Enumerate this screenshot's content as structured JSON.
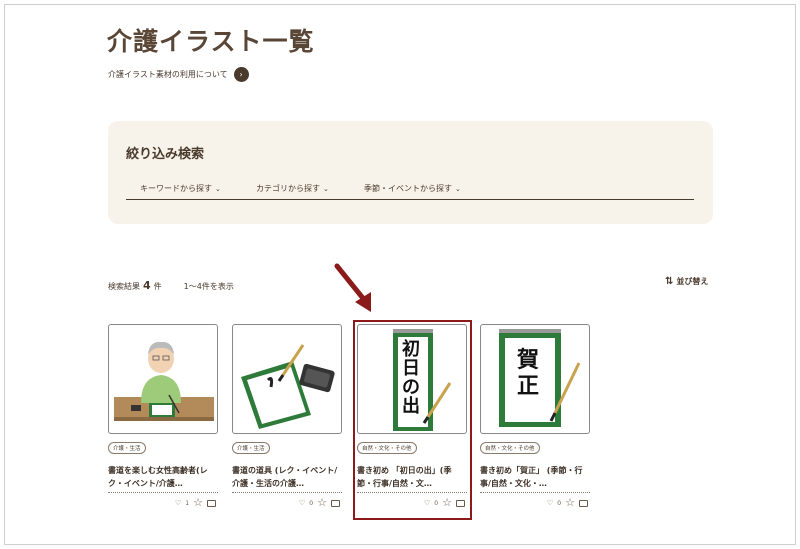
{
  "page": {
    "title": "介護イラスト一覧"
  },
  "about_link": {
    "label": "介護イラスト素材の利用について"
  },
  "filter": {
    "title": "絞り込み検索",
    "tabs": [
      {
        "label": "キーワードから探す"
      },
      {
        "label": "カテゴリから探す"
      },
      {
        "label": "季節・イベントから探す"
      }
    ]
  },
  "results": {
    "label": "検索結果",
    "count": "4",
    "unit": "件",
    "range": "1～4件を表示",
    "sort_label": "並び替え"
  },
  "cards": [
    {
      "tag": "介護・生活",
      "title": "書道を楽しむ女性高齢者(レク・イベント/介護…",
      "likes": "1",
      "thumb_icon": "elderly-calligraphy"
    },
    {
      "tag": "介護・生活",
      "title": "書道の道具 (レク・イベント/介護・生活の介護…",
      "likes": "0",
      "thumb_icon": "calligraphy-tools"
    },
    {
      "tag": "自然・文化・その他",
      "title": "書き初め 「初日の出」(季節・行事/自然・文…",
      "likes": "0",
      "thumb_icon": "kakizome-hatsuhinode",
      "thumb_text": "初日の出"
    },
    {
      "tag": "自然・文化・その他",
      "title": "書き初め「賀正」 (季節・行事/自然・文化・…",
      "likes": "0",
      "thumb_icon": "kakizome-gashou",
      "thumb_text": "賀正"
    }
  ],
  "colors": {
    "accent": "#4a3a2c",
    "filter_bg": "#f7f3ea",
    "highlight": "#8b1a1a"
  }
}
